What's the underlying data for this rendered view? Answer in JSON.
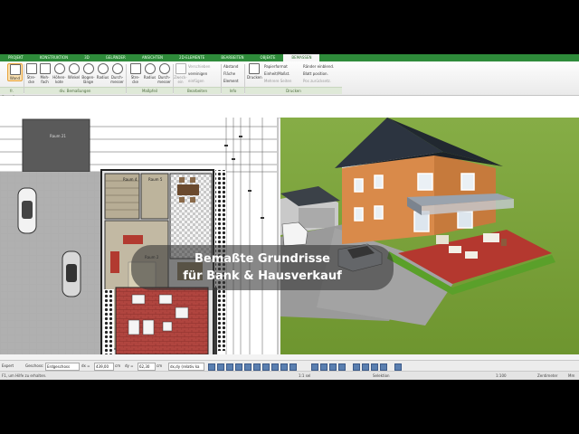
{
  "menu": {
    "tabs": [
      "PROJEKT",
      "KONSTRUKTION",
      "3D",
      "GELÄNDER",
      "ANSICHTEN",
      "2D-ELEMENTE",
      "BEARBEITEN",
      "OBJEKTE",
      "BEMASSEN"
    ],
    "active_tab": "BEMASSEN"
  },
  "ribbon": {
    "groups": [
      {
        "label": "fr. Bemaßung",
        "tools": [
          "Wand"
        ]
      },
      {
        "label": "div. Bemaßungen",
        "tools": [
          "Stre-cke",
          "Meh-fach",
          "Höhen-kote",
          "Winkel",
          "Bogen-länge",
          "Radius",
          "Durch-messer"
        ]
      },
      {
        "label": "Maßpfeil",
        "tools": [
          "Stre-cke",
          "Radius",
          "Durch-messer"
        ]
      },
      {
        "label": "Bearbeiten",
        "tools": [
          "Zweck-ein"
        ],
        "items": [
          "Verschieben",
          "vereinigen",
          "einfügen"
        ]
      },
      {
        "label": "Info",
        "items": [
          "Abstand",
          "Fläche",
          "Element"
        ]
      },
      {
        "label": "Drucken",
        "tools": [
          "Drucken"
        ],
        "items": [
          "Papierformat",
          "Einheit/Maßst.",
          "Mehrere Seiten",
          "Ränder einblend.",
          "Blatt position.",
          "Pos zurücksetz."
        ]
      }
    ]
  },
  "plan": {
    "room_labels": [
      "Raum 21",
      "Raum 4",
      "Raum 5",
      "Raum 2"
    ]
  },
  "caption": {
    "line1": "Bemaßte Grundrisse",
    "line2": "für Bank & Hausverkauf"
  },
  "bottom": {
    "view_label": "Expert",
    "floor_label": "Geschoss:",
    "floor_value": "Erdgeschoss",
    "dx_label": "dx =",
    "dx_value": "439,00",
    "dx_unit": "cm",
    "dy_label": "dy =",
    "dy_value": "62,30",
    "dy_unit": "cm",
    "rel_value": "dx,dy (relativ ka"
  },
  "status": {
    "hint": "F1, um Hilfe zu erhalten.",
    "ratio": "1:1 sel",
    "mode": "Selektion",
    "scale": "1:100",
    "unit": "Zentimeter",
    "mode2": "Mm"
  },
  "colors": {
    "menubar": "#2e8b3a",
    "active_tool": "#fbe1b0",
    "roof": "#2c3440",
    "facade": "#d98a4a",
    "terrace": "#b4382f",
    "lawn": "#7aa33c"
  }
}
